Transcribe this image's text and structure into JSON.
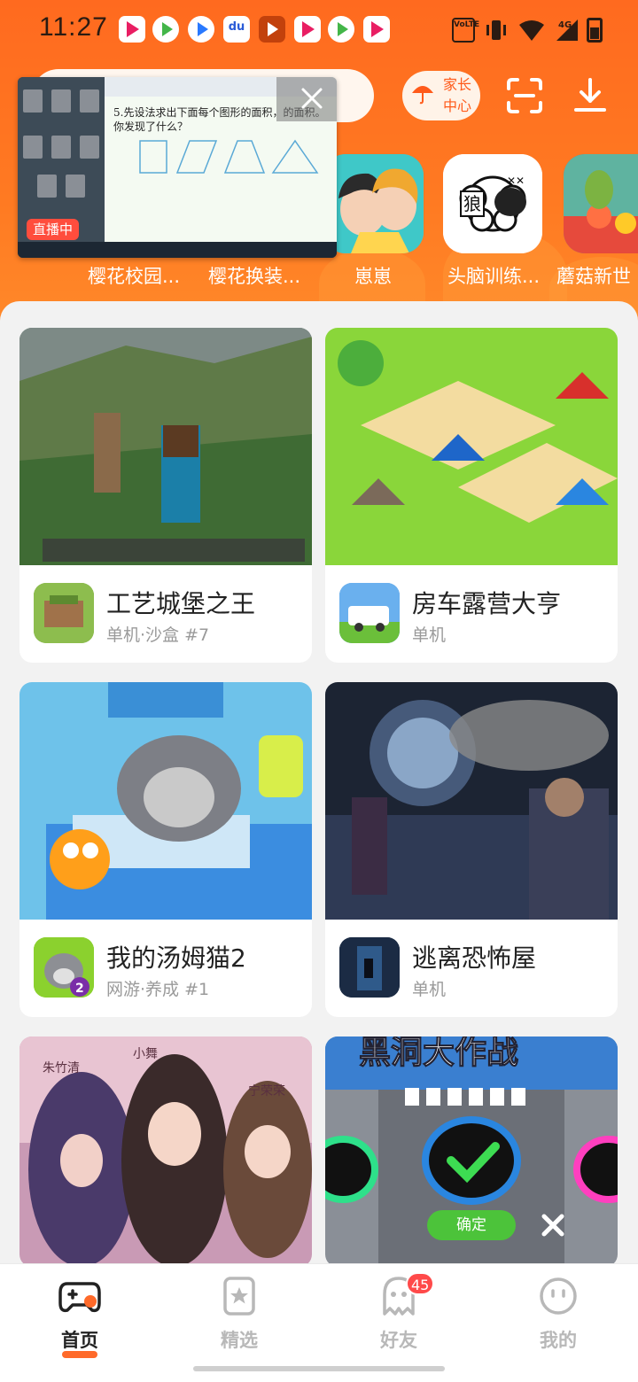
{
  "status_bar": {
    "time": "11:27",
    "volte": "VoLTE",
    "network": "4G"
  },
  "header": {
    "parent_center_label": "家长中心",
    "live_overlay": {
      "status_tag": "直播中",
      "question_text": "5.先设法求出下面每个图形的面积，的面积。你发现了什么？"
    },
    "apps": [
      {
        "label": "樱花校园..."
      },
      {
        "label": "樱花换装..."
      },
      {
        "label": "崽崽"
      },
      {
        "label": "头脑训练..."
      },
      {
        "label": "蘑菇新世"
      }
    ],
    "wolf_char": "狼"
  },
  "feed": {
    "cards": [
      {
        "name": "工艺城堡之王",
        "subtitle": "单机·沙盒 #7"
      },
      {
        "name": "房车露营大亨",
        "subtitle": "单机"
      },
      {
        "name": "我的汤姆猫2",
        "subtitle": "网游·养成 #1"
      },
      {
        "name": "逃离恐怖屋",
        "subtitle": "单机"
      },
      {
        "name": "",
        "subtitle": ""
      },
      {
        "name": "",
        "subtitle": ""
      }
    ],
    "card5_overlay": {
      "names": [
        "朱竹清",
        "小舞",
        "宁荣荣"
      ]
    },
    "card6_overlay": {
      "title": "黑洞大作战",
      "confirm_label": "确定"
    },
    "tom_badge": "2"
  },
  "bottom_nav": {
    "items": [
      {
        "label": "首页",
        "active": true
      },
      {
        "label": "精选",
        "active": false
      },
      {
        "label": "好友",
        "active": false
      },
      {
        "label": "我的",
        "active": false
      }
    ],
    "friends_badge": "45"
  },
  "colors": {
    "header_orange": "#ff7a22",
    "accent": "#ff5a1a",
    "badge_red": "#ff4a4a"
  }
}
